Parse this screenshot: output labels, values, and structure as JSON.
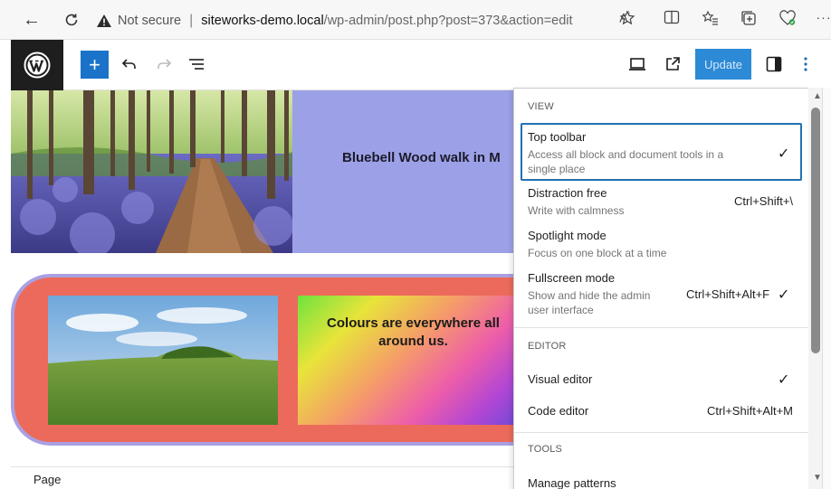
{
  "browser": {
    "security_label": "Not secure",
    "url_domain": "siteworks-demo.local",
    "url_path": "/wp-admin/post.php?post=373&action=edit",
    "icons": [
      "back-icon",
      "refresh-icon",
      "warning-icon",
      "read-aloud-icon",
      "favorite-icon",
      "split-screen-icon",
      "favorites-list-icon",
      "collections-icon",
      "extensions-icon",
      "more-icon"
    ]
  },
  "toolbar": {
    "update_label": "Update",
    "icons": [
      "wordpress-logo",
      "add-block-icon",
      "undo-icon",
      "redo-icon",
      "list-view-icon",
      "preview-device-icon",
      "view-post-icon",
      "settings-sidebar-icon",
      "options-icon"
    ],
    "accent": "#1a73c9"
  },
  "content": {
    "block1_title": "Bluebell Wood walk in M",
    "block2_title": "Colours are everywhere all around us.",
    "colors": {
      "lavender": "#9ca0e6",
      "coral": "#ec6a5b",
      "border": "#a9a0e2"
    }
  },
  "footer": {
    "breadcrumb": "Page"
  },
  "options_menu": {
    "view_title": "VIEW",
    "items": {
      "top_toolbar": {
        "label": "Top toolbar",
        "desc": "Access all block and document tools in a single place",
        "checked": true
      },
      "distraction_free": {
        "label": "Distraction free",
        "desc": "Write with calmness",
        "shortcut": "Ctrl+Shift+\\"
      },
      "spotlight": {
        "label": "Spotlight mode",
        "desc": "Focus on one block at a time"
      },
      "fullscreen": {
        "label": "Fullscreen mode",
        "desc": "Show and hide the admin user interface",
        "shortcut": "Ctrl+Shift+Alt+F",
        "checked": true
      }
    },
    "editor_title": "EDITOR",
    "editor_items": {
      "visual": {
        "label": "Visual editor",
        "checked": true
      },
      "code": {
        "label": "Code editor",
        "shortcut": "Ctrl+Shift+Alt+M"
      }
    },
    "tools_title": "TOOLS",
    "tools_items": {
      "manage_patterns": {
        "label": "Manage patterns"
      }
    },
    "check_glyph": "✓"
  }
}
